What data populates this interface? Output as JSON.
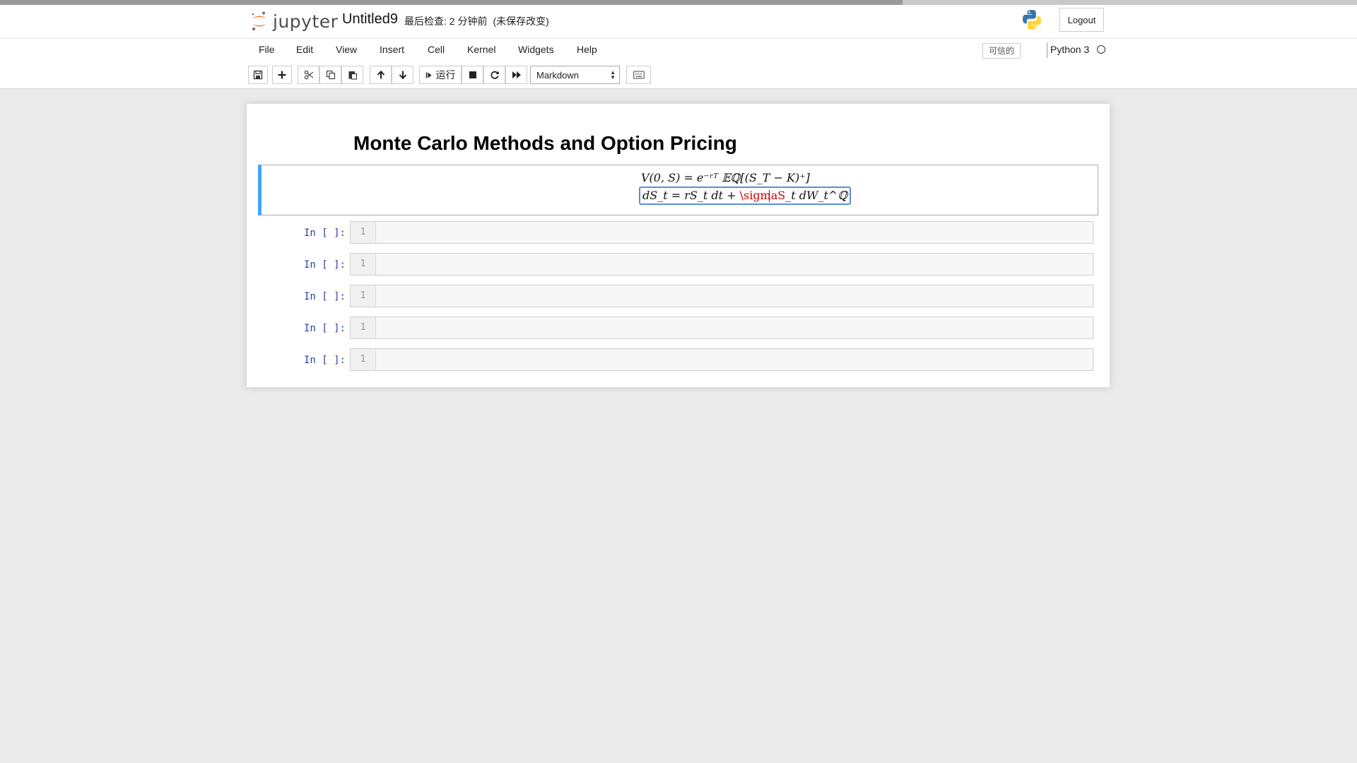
{
  "header": {
    "logo_text": "jupyter",
    "notebook_name": "Untitled9",
    "checkpoint": "最后检查: 2 分钟前",
    "autosave_status": "(未保存改变)",
    "logout_label": "Logout",
    "icons": {
      "logo": "jupyter-logo",
      "kernel_logo": "python-logo-icon"
    }
  },
  "menubar": {
    "items": [
      "File",
      "Edit",
      "View",
      "Insert",
      "Cell",
      "Kernel",
      "Widgets",
      "Help"
    ],
    "trusted_label": "可信的",
    "kernel_name": "Python 3"
  },
  "toolbar": {
    "run_label": "运行",
    "cell_type": "Markdown",
    "icons": [
      "save-icon",
      "add-cell-icon",
      "cut-icon",
      "copy-icon",
      "paste-icon",
      "move-up-icon",
      "move-down-icon",
      "run-icon",
      "stop-icon",
      "restart-icon",
      "fast-forward-icon",
      "keyboard-icon"
    ]
  },
  "notebook": {
    "heading": "Monte Carlo Methods and Option Pricing",
    "markdown_cell": {
      "line1": "V(0, S) = e⁻ʳᵀ 𝔼ℚ[(S_T − K)⁺]",
      "line2_prefix": "dS_t = rS_t dt + ",
      "line2_error": "\\sigmaS",
      "line2_suffix": "_t dW_t^ℚ"
    },
    "code_cells": [
      {
        "prompt": "In [ ]:",
        "line_number": "1",
        "content": ""
      },
      {
        "prompt": "In [ ]:",
        "line_number": "1",
        "content": ""
      },
      {
        "prompt": "In [ ]:",
        "line_number": "1",
        "content": ""
      },
      {
        "prompt": "In [ ]:",
        "line_number": "1",
        "content": ""
      },
      {
        "prompt": "In [ ]:",
        "line_number": "1",
        "content": ""
      }
    ]
  },
  "colors": {
    "accent_selected_cell": "#42a5f5",
    "prompt": "#303f9f",
    "math_error": "#cc0000",
    "background": "#eaeaea"
  }
}
